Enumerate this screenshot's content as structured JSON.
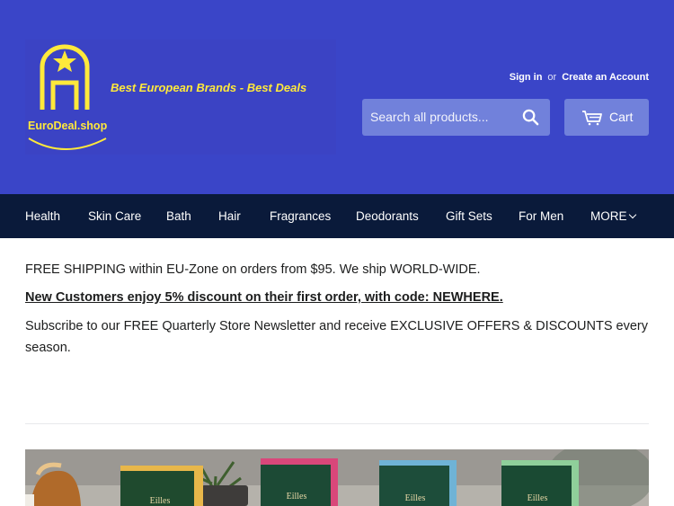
{
  "header": {
    "logo_name": "EuroDeal.shop",
    "tagline": "Best European Brands - Best Deals",
    "sign_in": "Sign in",
    "or": "or",
    "create_account": "Create an Account",
    "search_placeholder": "Search all products...",
    "cart_label": "Cart"
  },
  "nav": {
    "items": [
      "Health",
      "Skin Care",
      "Bath",
      "Hair",
      "Fragrances",
      "Deodorants",
      "Gift Sets",
      "For Men"
    ],
    "more_label": "MORE"
  },
  "content": {
    "shipping": "FREE SHIPPING within EU-Zone on orders from $95. We ship WORLD-WIDE.",
    "discount": "New Customers enjoy 5% discount on their first order, with code: NEWHERE.",
    "newsletter": "Subscribe to our FREE Quarterly Store Newsletter and receive EXCLUSIVE OFFERS & DISCOUNTS every season."
  },
  "banner": {
    "brand": "Eilles",
    "box_colors": [
      "#1f4a2e",
      "#1c4a35",
      "#1d4d3a",
      "#1a4a33"
    ],
    "accent_colors": [
      "#e8b74a",
      "#d9477a",
      "#6fb3d6",
      "#8fcf9a"
    ]
  },
  "colors": {
    "header_bg": "#3a45c8",
    "nav_bg": "#0a1a3a",
    "logo_yellow": "#ffe93b",
    "button_bg": "#7181db"
  },
  "icons": {
    "logo": "star-arch-logo",
    "search": "search-icon",
    "cart": "cart-icon",
    "more": "chevron-down-icon"
  }
}
